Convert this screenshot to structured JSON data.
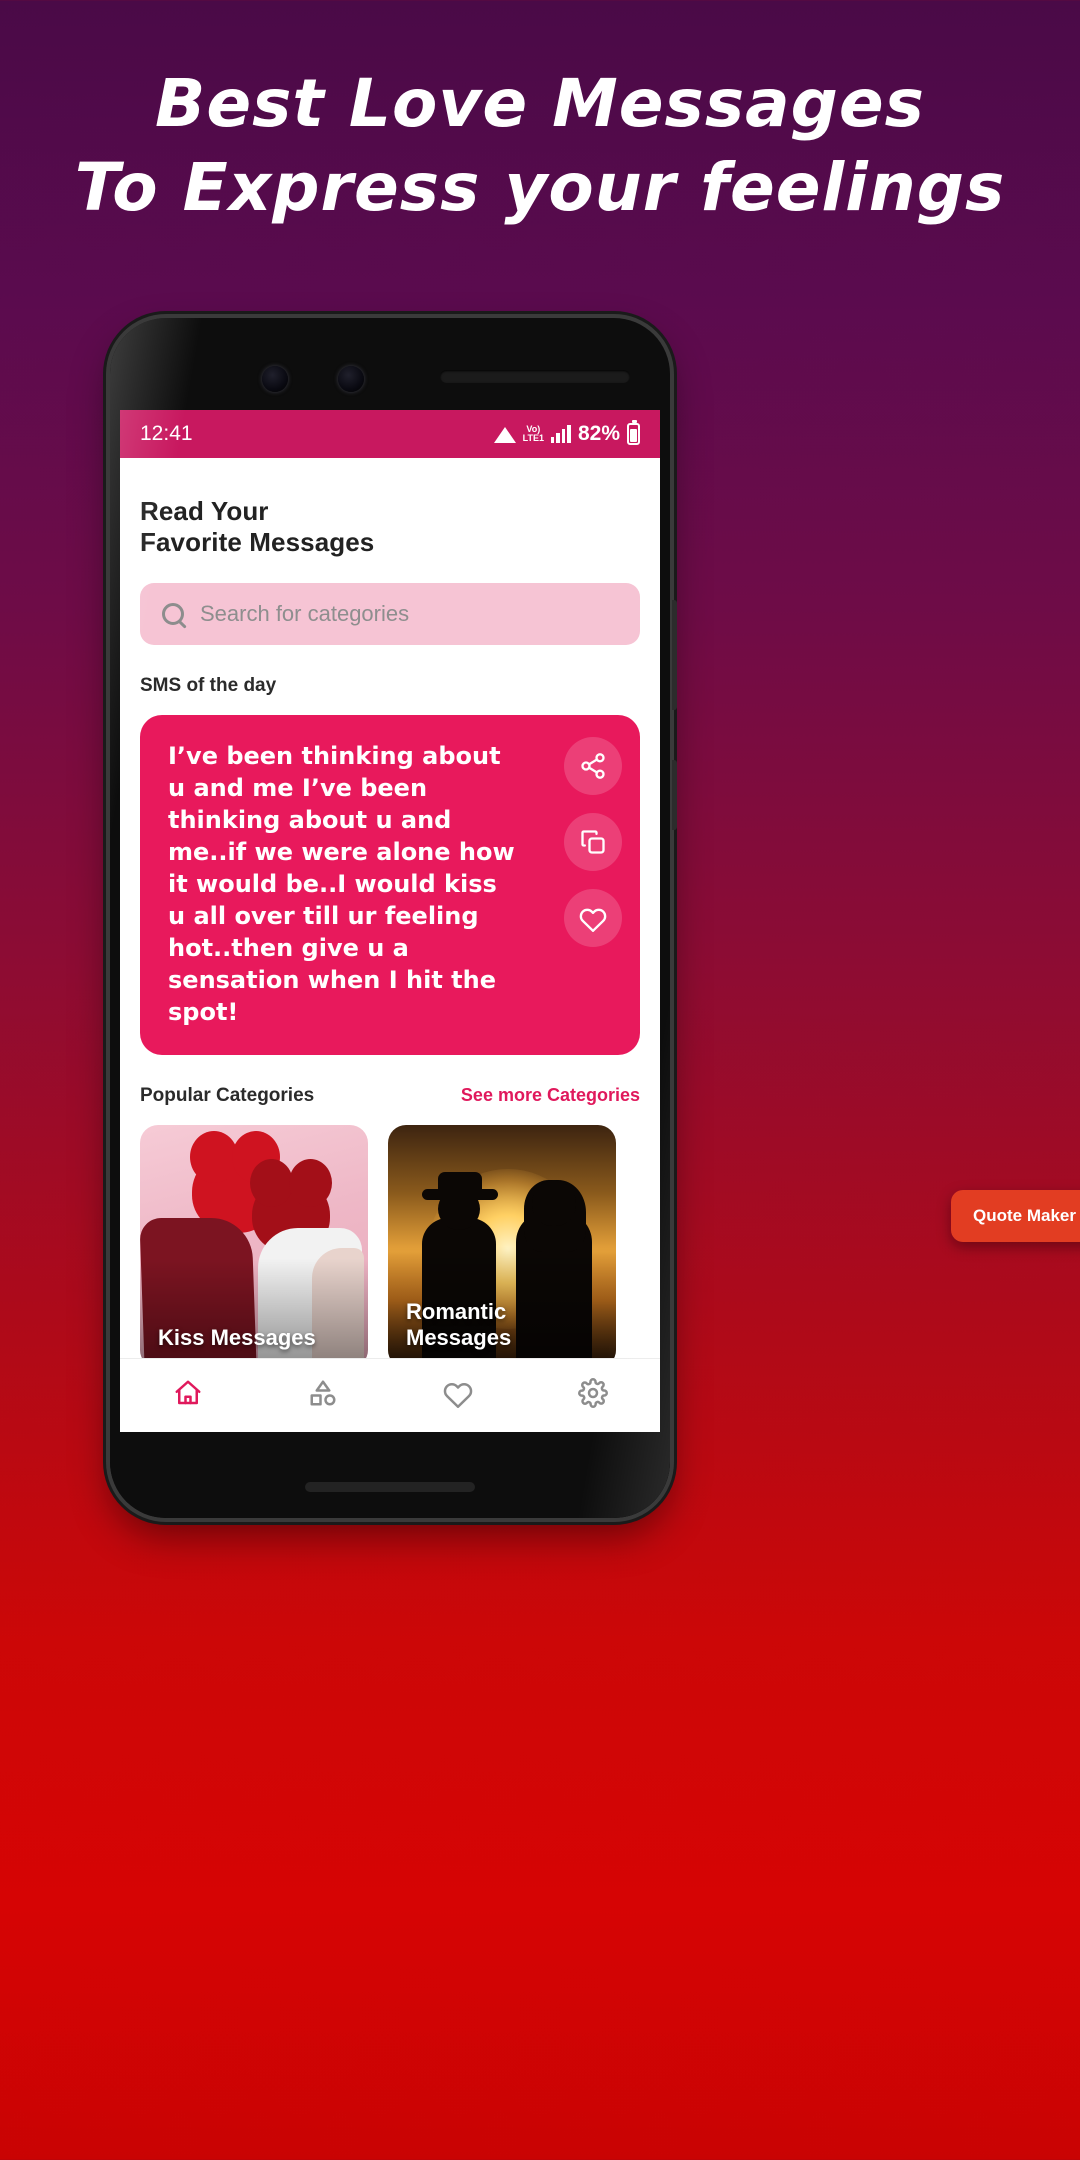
{
  "promo": {
    "line1": "Best Love Messages",
    "line2": "To Express your feelings"
  },
  "status_bar": {
    "time": "12:41",
    "volte_top": "Vo)",
    "volte_bottom": "LTE1",
    "battery": "82%",
    "wifi_icon": "wifi-icon",
    "signal_icon": "cellular-signal-icon",
    "battery_icon": "battery-icon"
  },
  "app": {
    "title_line1": "Read Your",
    "title_line2": "Favorite Messages",
    "search": {
      "placeholder": "Search for categories",
      "icon": "search-icon"
    },
    "sms_section": {
      "label": "SMS of the day",
      "message": "I’ve been thinking about u and me I’ve been thinking about u and me..if we were alone how it would be..I would kiss u all over till ur feeling hot..then give u a sensation when I hit the spot!",
      "actions": [
        {
          "name": "share-button",
          "icon": "share-icon"
        },
        {
          "name": "copy-button",
          "icon": "copy-icon"
        },
        {
          "name": "favorite-button",
          "icon": "heart-icon"
        }
      ]
    },
    "categories": {
      "label": "Popular Categories",
      "see_more": "See more Categories",
      "items": [
        {
          "label": "Kiss Messages"
        },
        {
          "label": "Romantic\nMessages"
        }
      ]
    },
    "quote_badge": "Quote Maker",
    "bottom_nav": [
      {
        "name": "nav-home",
        "label": "home-icon",
        "active": true
      },
      {
        "name": "nav-categories",
        "label": "categories-icon",
        "active": false
      },
      {
        "name": "nav-favorites",
        "label": "heart-icon",
        "active": false
      },
      {
        "name": "nav-settings",
        "label": "gear-icon",
        "active": false
      }
    ]
  },
  "colors": {
    "accent_pink": "#e0195c",
    "status_pink": "#c8185f",
    "card_pink": "#e8195c",
    "search_pink": "#f6c4d4",
    "badge_orange": "#e23d22"
  }
}
